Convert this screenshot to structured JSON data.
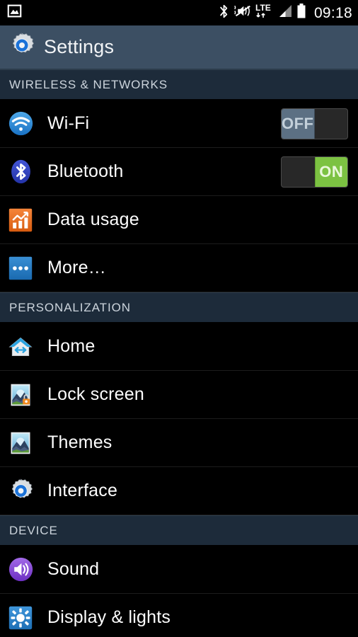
{
  "status_bar": {
    "left_icons": [
      {
        "name": "screenshot-notification-icon",
        "glyph": "image"
      }
    ],
    "right_icons": [
      {
        "name": "bluetooth-status-icon",
        "glyph": "bluetooth"
      },
      {
        "name": "vibrate-mute-icon",
        "glyph": "mute"
      },
      {
        "name": "lte-data-icon",
        "glyph": "lte",
        "text": "LTE"
      },
      {
        "name": "signal-bars-icon",
        "glyph": "signal"
      },
      {
        "name": "battery-icon",
        "glyph": "battery"
      }
    ],
    "clock": "09:18"
  },
  "action_bar": {
    "icon": "settings-gear-icon",
    "title": "Settings"
  },
  "sections": [
    {
      "header": "WIRELESS & NETWORKS",
      "rows": [
        {
          "label": "Wi-Fi",
          "icon": "wifi-icon",
          "toggle": "OFF"
        },
        {
          "label": "Bluetooth",
          "icon": "bluetooth-icon",
          "toggle": "ON"
        },
        {
          "label": "Data usage",
          "icon": "data-usage-icon",
          "toggle": null
        },
        {
          "label": "More…",
          "icon": "more-icon",
          "toggle": null
        }
      ]
    },
    {
      "header": "PERSONALIZATION",
      "rows": [
        {
          "label": "Home",
          "icon": "home-icon",
          "toggle": null
        },
        {
          "label": "Lock screen",
          "icon": "lock-screen-icon",
          "toggle": null
        },
        {
          "label": "Themes",
          "icon": "themes-icon",
          "toggle": null
        },
        {
          "label": "Interface",
          "icon": "interface-icon",
          "toggle": null
        }
      ]
    },
    {
      "header": "DEVICE",
      "rows": [
        {
          "label": "Sound",
          "icon": "sound-icon",
          "toggle": null
        },
        {
          "label": "Display & lights",
          "icon": "display-icon",
          "toggle": null
        }
      ]
    }
  ],
  "colors": {
    "action_bar": "#3c4f63",
    "section_header": "#1d2b3a",
    "toggle_on": "#7cc242",
    "toggle_off": "#5c7083",
    "background": "#000000"
  }
}
